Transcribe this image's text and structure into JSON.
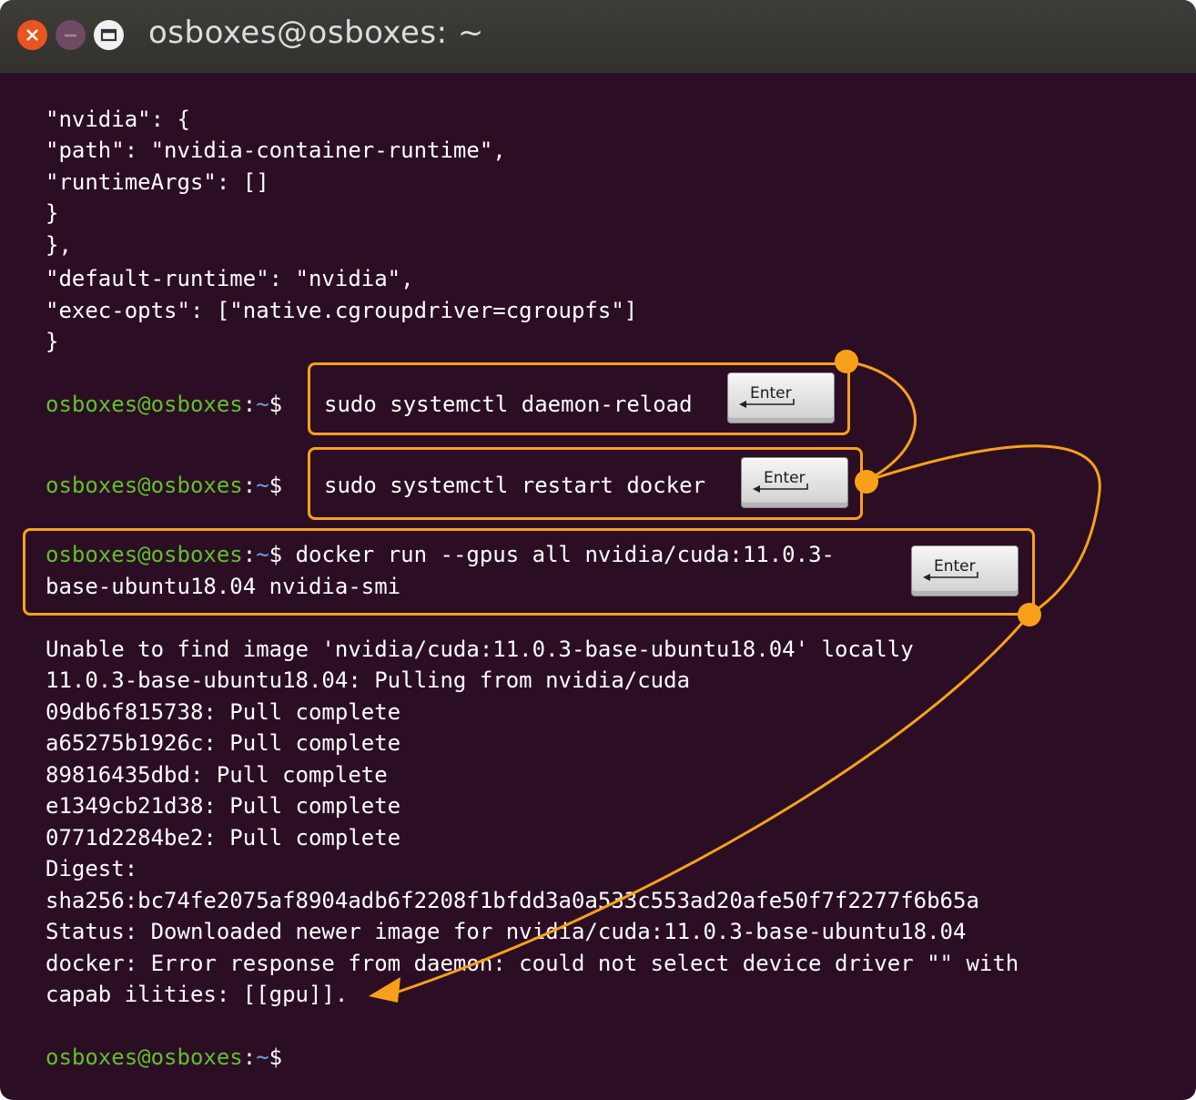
{
  "window": {
    "title": "osboxes@osboxes: ~"
  },
  "prompt": {
    "user": "osboxes@osboxes",
    "sep": ":",
    "path": "~",
    "symbol": "$"
  },
  "json_lines": [
    "\"nvidia\": {",
    "\"path\": \"nvidia-container-runtime\",",
    "\"runtimeArgs\": []",
    "}",
    "},",
    "\"default-runtime\": \"nvidia\",",
    "\"exec-opts\": [\"native.cgroupdriver=cgroupfs\"]",
    "}"
  ],
  "commands": {
    "cmd1": "sudo systemctl daemon-reload",
    "cmd2": "sudo systemctl restart docker",
    "cmd3_line1": "docker run --gpus all nvidia/cuda:11.0.3-",
    "cmd3_line2": "base-ubuntu18.04 nvidia-smi"
  },
  "enter_key_label": "Enter",
  "output_lines": [
    "Unable to find image 'nvidia/cuda:11.0.3-base-ubuntu18.04' locally",
    "11.0.3-base-ubuntu18.04: Pulling from nvidia/cuda",
    "09db6f815738: Pull complete",
    "a65275b1926c: Pull complete",
    "89816435dbd: Pull complete",
    "e1349cb21d38: Pull complete",
    "0771d2284be2: Pull complete",
    "Digest:",
    "sha256:bc74fe2075af8904adb6f2208f1bfdd3a0a533c553ad20afe50f7f2277f6b65a",
    "Status: Downloaded newer image for nvidia/cuda:11.0.3-base-ubuntu18.04",
    "docker: Error response from daemon: could not select device driver \"\" with",
    "capab ilities: [[gpu]]."
  ],
  "colors": {
    "background": "#2c0e24",
    "prompt_user": "#5fc12c",
    "prompt_path": "#6aa3e4",
    "annotation": "#f7a11b"
  },
  "icons": [
    "close-icon",
    "minimize-icon",
    "maximize-icon",
    "enter-key-icon"
  ]
}
